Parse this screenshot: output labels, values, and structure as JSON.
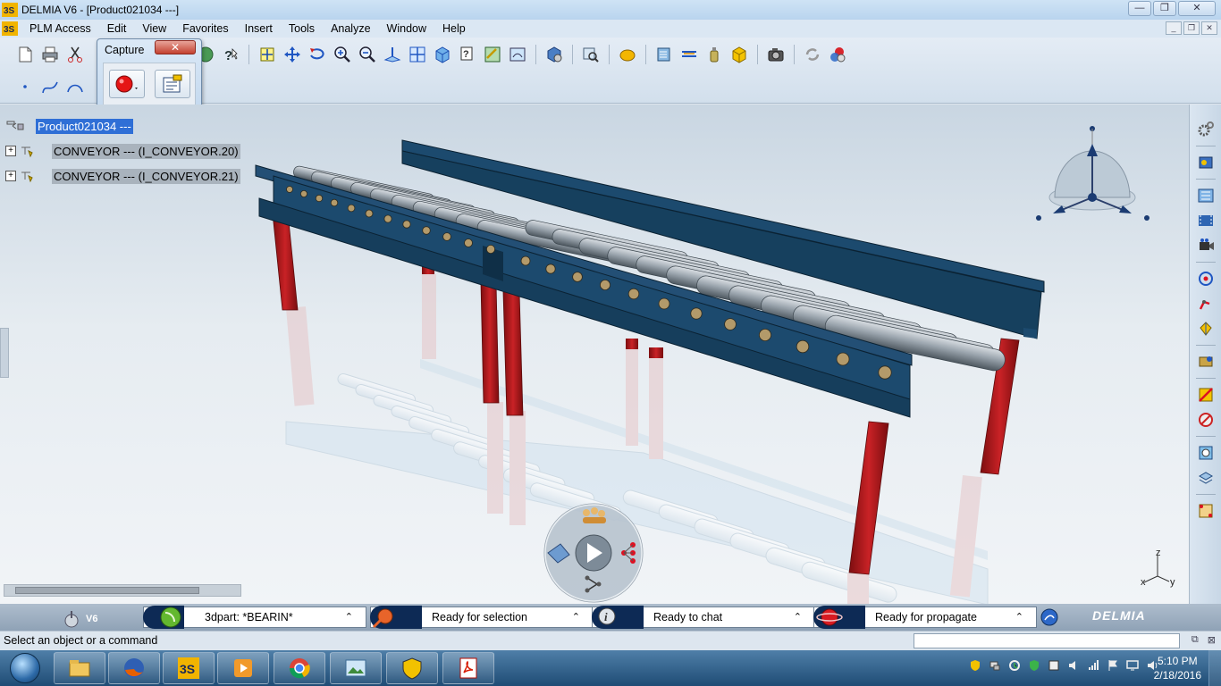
{
  "window": {
    "title": "DELMIA V6 - [Product021034 ---]"
  },
  "window_controls": {
    "minimize": "—",
    "restore": "❐",
    "close": "✕"
  },
  "menu": {
    "items": [
      {
        "label": "PLM Access",
        "accel": ""
      },
      {
        "label": "Edit",
        "accel": "E"
      },
      {
        "label": "View",
        "accel": "V"
      },
      {
        "label": "Favorites",
        "accel": "F"
      },
      {
        "label": "Insert",
        "accel": "I"
      },
      {
        "label": "Tools",
        "accel": "T"
      },
      {
        "label": "Analyze",
        "accel": "A"
      },
      {
        "label": "Window",
        "accel": "W"
      },
      {
        "label": "Help",
        "accel": "H"
      }
    ]
  },
  "capture": {
    "title": "Capture",
    "close": "✕"
  },
  "tree": {
    "root": "Product021034 ---",
    "children": [
      "CONVEYOR --- (I_CONVEYOR.20)",
      "CONVEYOR --- (I_CONVEYOR.21)"
    ]
  },
  "compass": {
    "x": "x",
    "y": "y",
    "z": "z"
  },
  "status": {
    "v6": "V6",
    "boxes": [
      {
        "text": "3dpart: *BEARIN*"
      },
      {
        "text": "Ready for selection"
      },
      {
        "text": "Ready to chat"
      },
      {
        "text": "Ready for propagate"
      }
    ],
    "brand": "DELMIA"
  },
  "prompt": {
    "text": "Select an object or a command"
  },
  "taskbar": {
    "time": "5:10 PM",
    "date": "2/18/2016"
  },
  "colors": {
    "beam": "#1c4a6e",
    "leg": "#a8161a",
    "roller": "#8f9aa3",
    "selection": "#2f6fd6"
  }
}
